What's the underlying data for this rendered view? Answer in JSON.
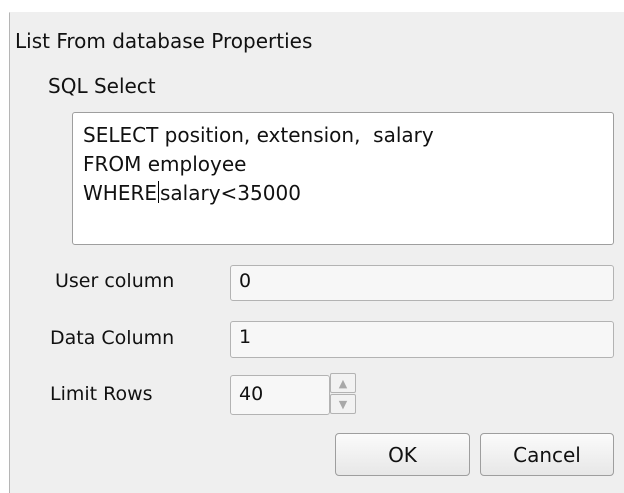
{
  "dialog": {
    "title": "List From database Properties",
    "sql_section_label": "SQL Select",
    "sql": {
      "line1": "SELECT position, extension,  salary",
      "line2": "FROM employee",
      "line3_before_cursor": "WHERE",
      "line3_after_cursor": "salary<35000"
    },
    "fields": {
      "user_column": {
        "label": "User column",
        "value": "0"
      },
      "data_column": {
        "label": "Data Column",
        "value": "1"
      },
      "limit_rows": {
        "label": "Limit Rows",
        "value": "40"
      }
    },
    "spinner": {
      "up_icon": "▲",
      "down_icon": "▼"
    },
    "buttons": {
      "ok": "OK",
      "cancel": "Cancel"
    }
  },
  "colors": {
    "dialog_bg": "#efefef",
    "field_bg": "#f7f7f7",
    "text_area_bg": "#ffffff",
    "border": "#9e9e9e"
  }
}
